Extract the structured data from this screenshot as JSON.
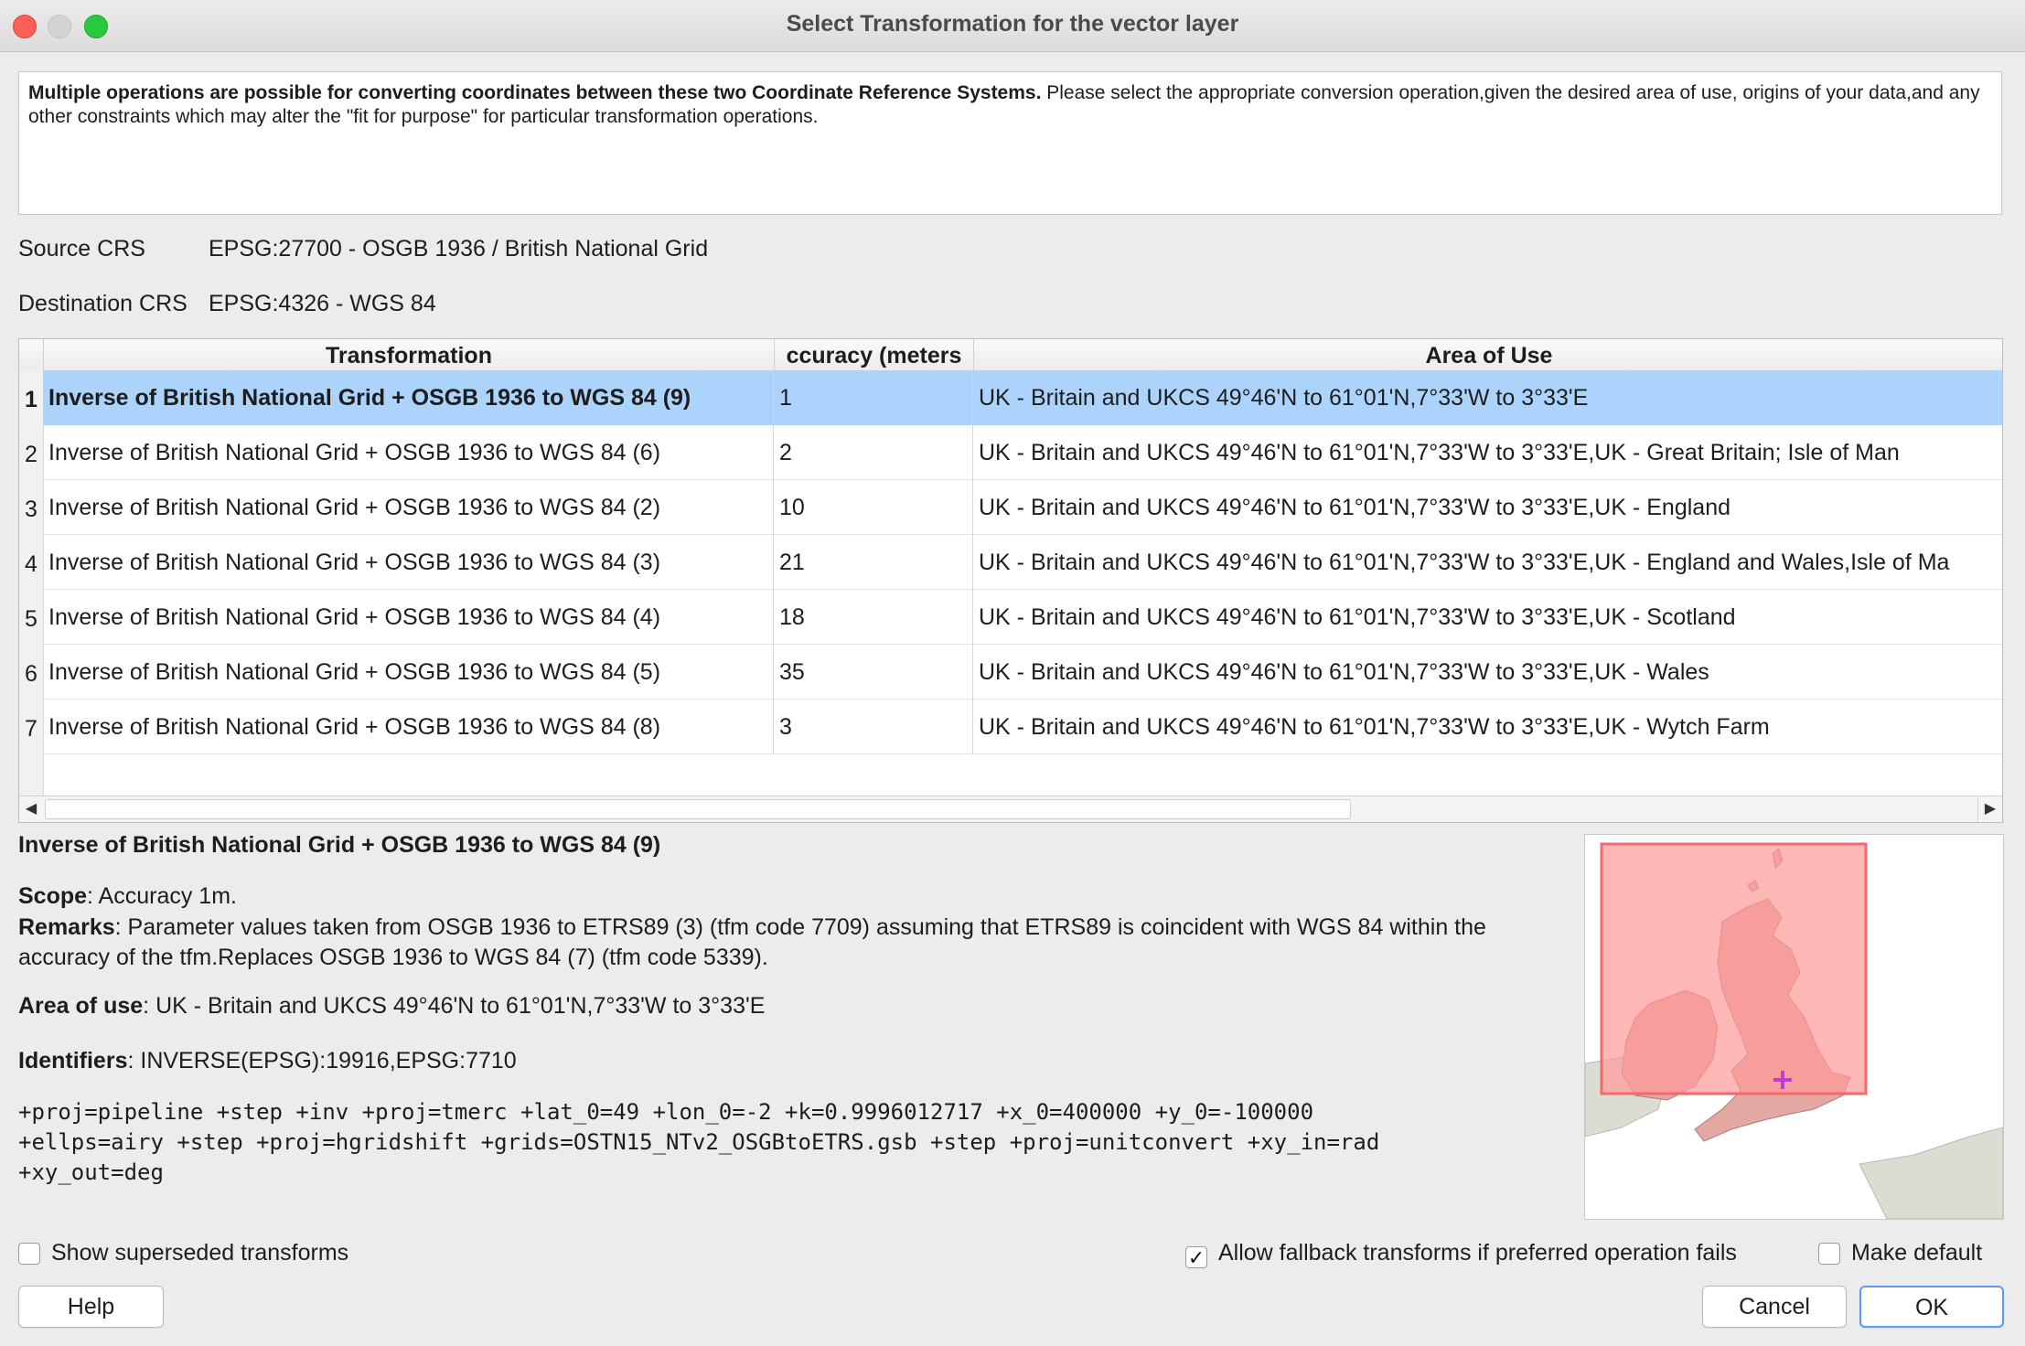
{
  "window": {
    "title": "Select Transformation for the vector layer"
  },
  "info": {
    "bold": "Multiple operations are possible for converting coordinates between these two Coordinate Reference Systems.",
    "text": " Please select the appropriate conversion operation,given the desired area of use, origins of your data,and any other constraints which may alter the \"fit for purpose\" for particular transformation operations."
  },
  "crs": {
    "source_label": "Source CRS",
    "source_value": "EPSG:27700 - OSGB 1936 / British National Grid",
    "dest_label": "Destination CRS",
    "dest_value": "EPSG:4326 - WGS 84"
  },
  "table": {
    "headers": [
      "Transformation",
      "ccuracy (meters",
      "Area of Use"
    ],
    "rows": [
      {
        "num": "1",
        "transformation": "Inverse of British National Grid + OSGB 1936 to WGS 84 (9)",
        "accuracy": "1",
        "area": "UK - Britain and UKCS 49°46'N to 61°01'N,7°33'W to 3°33'E"
      },
      {
        "num": "2",
        "transformation": "Inverse of British National Grid + OSGB 1936 to WGS 84 (6)",
        "accuracy": "2",
        "area": "UK - Britain and UKCS 49°46'N to 61°01'N,7°33'W to 3°33'E,UK - Great Britain; Isle of Man"
      },
      {
        "num": "3",
        "transformation": "Inverse of British National Grid + OSGB 1936 to WGS 84 (2)",
        "accuracy": "10",
        "area": "UK - Britain and UKCS 49°46'N to 61°01'N,7°33'W to 3°33'E,UK - England"
      },
      {
        "num": "4",
        "transformation": "Inverse of British National Grid + OSGB 1936 to WGS 84 (3)",
        "accuracy": "21",
        "area": "UK - Britain and UKCS 49°46'N to 61°01'N,7°33'W to 3°33'E,UK - England and Wales,Isle of Ma"
      },
      {
        "num": "5",
        "transformation": "Inverse of British National Grid + OSGB 1936 to WGS 84 (4)",
        "accuracy": "18",
        "area": "UK - Britain and UKCS 49°46'N to 61°01'N,7°33'W to 3°33'E,UK - Scotland"
      },
      {
        "num": "6",
        "transformation": "Inverse of British National Grid + OSGB 1936 to WGS 84 (5)",
        "accuracy": "35",
        "area": "UK - Britain and UKCS 49°46'N to 61°01'N,7°33'W to 3°33'E,UK - Wales"
      },
      {
        "num": "7",
        "transformation": "Inverse of British National Grid + OSGB 1936 to WGS 84 (8)",
        "accuracy": "3",
        "area": "UK - Britain and UKCS 49°46'N to 61°01'N,7°33'W to 3°33'E,UK - Wytch Farm"
      }
    ],
    "selected_row": 0,
    "scroll_left_icon": "arrow-left-icon",
    "scroll_right_icon": "arrow-right-icon"
  },
  "details": {
    "title": "Inverse of British National Grid + OSGB 1936 to WGS 84 (9)",
    "scope_label": "Scope",
    "scope_value": ": Accuracy 1m.",
    "remarks_label": "Remarks",
    "remarks_value": ": Parameter values taken from OSGB 1936 to ETRS89 (3) (tfm code 7709) assuming that ETRS89 is coincident with WGS 84 within the accuracy of the tfm.Replaces OSGB 1936 to WGS 84 (7) (tfm code 5339).",
    "area_label": "Area of use",
    "area_value": ": UK - Britain and UKCS 49°46'N to 61°01'N,7°33'W to 3°33'E",
    "identifiers_label": "Identifiers",
    "identifiers_value": ": INVERSE(EPSG):19916,EPSG:7710",
    "proj_lines": [
      "+proj=pipeline +step +inv +proj=tmerc +lat_0=49 +lon_0=-2 +k=0.9996012717 +x_0=400000 +y_0=-100000",
      "+ellps=airy +step +proj=hgridshift +grids=OSTN15_NTv2_OSGBtoETRS.gsb +step +proj=unitconvert +xy_in=rad",
      "+xy_out=deg"
    ]
  },
  "map": {
    "extent_color": "#ff9a9a",
    "marker_color": "#c23bd4"
  },
  "options": {
    "show_superseded": {
      "label": "Show superseded transforms",
      "checked": false
    },
    "allow_fallback": {
      "label": "Allow fallback transforms if preferred operation fails",
      "checked": true
    },
    "make_default": {
      "label": "Make default",
      "checked": false
    }
  },
  "buttons": {
    "help": "Help",
    "cancel": "Cancel",
    "ok": "OK"
  }
}
